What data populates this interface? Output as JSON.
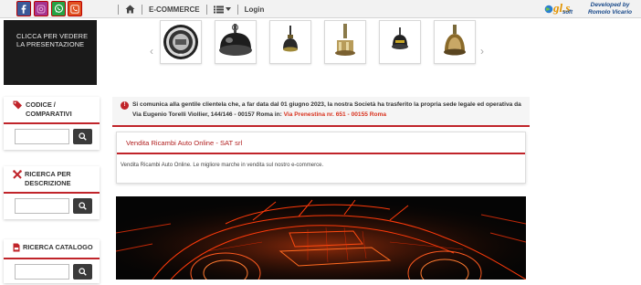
{
  "topbar": {
    "social": [
      {
        "name": "facebook-icon",
        "glyph": "f",
        "bg": "#3b5998"
      },
      {
        "name": "instagram-icon",
        "glyph": "",
        "bg": "#a4348f"
      },
      {
        "name": "whatsapp-icon",
        "glyph": "",
        "bg": "#25a244"
      },
      {
        "name": "phone-icon",
        "glyph": "",
        "bg": "#e05020"
      }
    ],
    "nav": {
      "home_icon": "home-icon",
      "ecommerce": "E-COMMERCE",
      "menu_icon": "list-icon",
      "login": "Login"
    },
    "brand": {
      "logo": "gl.s",
      "soft": "soft",
      "developed_by": "Developed by",
      "author": "Romolo Vicario"
    }
  },
  "promo": {
    "line1": "CLICCA PER VEDERE",
    "line2": "LA PRESENTAZIONE"
  },
  "carousel": {
    "prev_icon": "chevron-left-icon",
    "next_icon": "chevron-right-icon"
  },
  "sidebar": {
    "codice": {
      "label_line1": "CODICE /",
      "label_line2": "COMPARATIVI",
      "icon": "tags-icon",
      "placeholder": ""
    },
    "ricerca_descrizione": {
      "label_line1": "RICERCA PER",
      "label_line2": "DESCRIZIONE",
      "icon": "tools-icon",
      "placeholder": ""
    },
    "ricerca_catalogo": {
      "label": "RICERCA CATALOGO",
      "icon": "pdf-file-icon",
      "placeholder": ""
    }
  },
  "notice": {
    "text": "Si comunica alla gentile clientela che, a far data dal 01 giugno 2023, la nostra Società ha trasferito la propria sede legale ed operativa da Via Eugenio Torelli Viollier, 144/146 - 00157 Roma in:",
    "address": "Via Prenestina nr. 651 - 00155 Roma"
  },
  "card": {
    "title": "Vendita Ricambi Auto Online - SAT srl",
    "body": "Vendita Ricambi Auto Online. Le migliore marche in vendita sul nostro e-commerce."
  },
  "colors": {
    "accent": "#c0242a",
    "address": "#d9331f",
    "brand_blue": "#1a4a8a",
    "brand_orange": "#e39400"
  }
}
